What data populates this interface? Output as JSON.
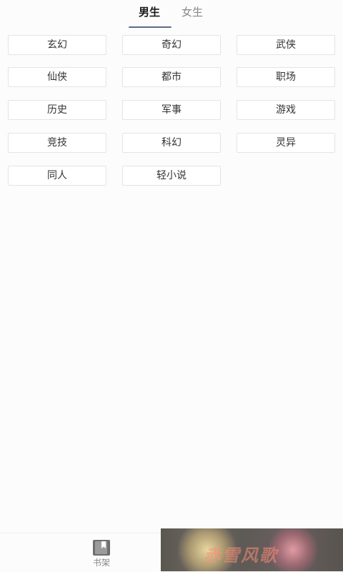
{
  "tabs": {
    "male": "男生",
    "female": "女生"
  },
  "categories": [
    "玄幻",
    "奇幻",
    "武侠",
    "仙侠",
    "都市",
    "职场",
    "历史",
    "军事",
    "游戏",
    "竞技",
    "科幻",
    "灵异",
    "同人",
    "轻小说"
  ],
  "bottom_nav": {
    "shelf_label": "书架",
    "shelf_icon": "book-icon"
  },
  "ad": {
    "text": "赤雪风歌"
  },
  "colors": {
    "tab_underline": "#5b6b86",
    "active_tab": "#1a1a1a",
    "inactive_tab": "#888888",
    "category_border": "#e4e4e7"
  }
}
